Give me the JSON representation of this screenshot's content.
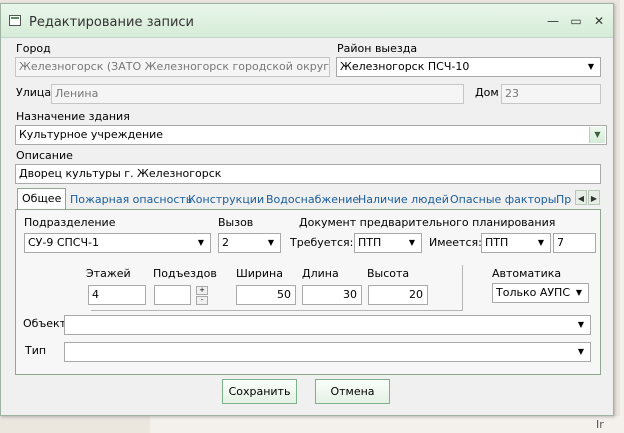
{
  "window": {
    "title": "Редактирование записи",
    "minimize": "—",
    "maximize": "▭",
    "close": "✕"
  },
  "form": {
    "city_label": "Город",
    "city_value": "Железногорск (ЗАТО Железногорск городской округ)",
    "district_label": "Район выезда",
    "district_value": "Железногорск ПСЧ-10",
    "street_label": "Улица",
    "street_value": "Ленина",
    "house_label": "Дом",
    "house_value": "23",
    "purpose_label": "Назначение здания",
    "purpose_value": "Культурное учреждение",
    "description_label": "Описание",
    "description_value": "Дворец культуры г. Железногорск"
  },
  "tabs": [
    {
      "label": "Общее"
    },
    {
      "label": "Пожарная опасность"
    },
    {
      "label": "Конструкции"
    },
    {
      "label": "Водоснабжение"
    },
    {
      "label": "Наличие людей"
    },
    {
      "label": "Опасные факторы"
    },
    {
      "label": "Пр"
    }
  ],
  "general": {
    "unit_label": "Подразделение",
    "unit_value": "СУ-9 СПСЧ-1",
    "call_label": "Вызов",
    "call_value": "2",
    "doc_label": "Документ предварительного планирования",
    "required_label": "Требуется:",
    "required_value": "ПТП",
    "available_label": "Имеется:",
    "available_value": "ПТП",
    "available_number": "7",
    "floors_label": "Этажей",
    "floors_value": "4",
    "entrances_label": "Подъездов",
    "entrances_value": "",
    "width_label": "Ширина",
    "width_value": "50",
    "length_label": "Длина",
    "length_value": "30",
    "height_label": "Высота",
    "height_value": "20",
    "automation_label": "Автоматика",
    "automation_value": "Только АУПС",
    "object_label": "Объект",
    "object_value": "",
    "type_label": "Тип",
    "type_value": ""
  },
  "buttons": {
    "save": "Сохранить",
    "cancel": "Отмена"
  },
  "map": {
    "corner_text": "Ir"
  }
}
